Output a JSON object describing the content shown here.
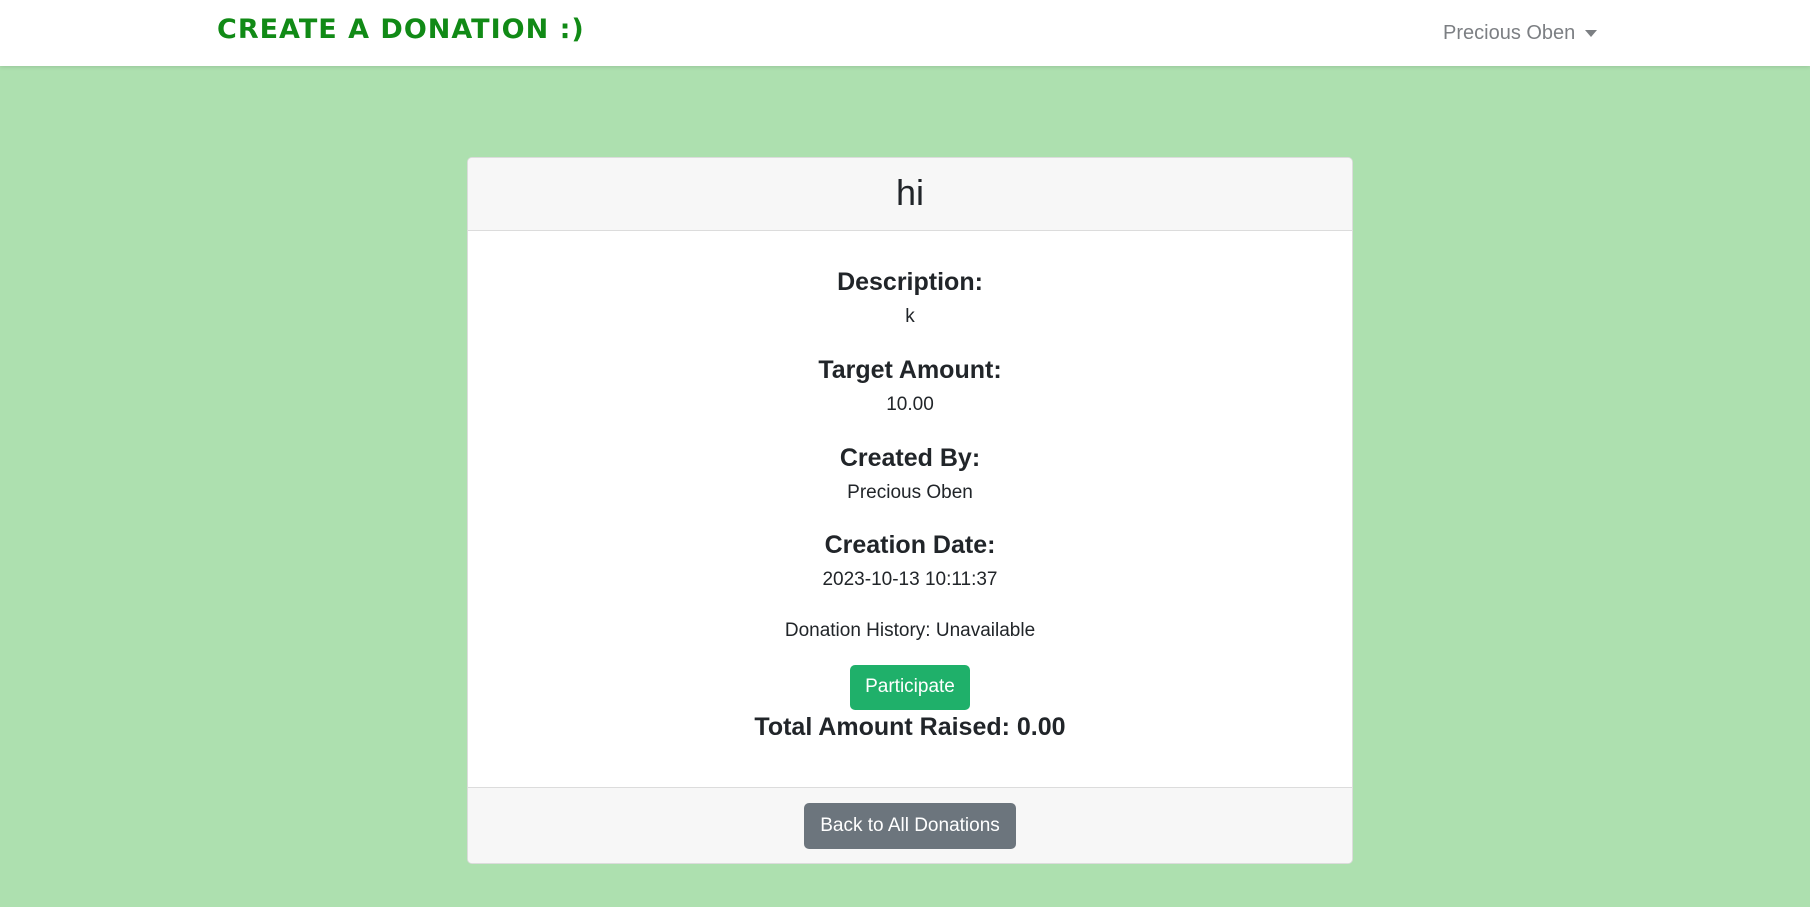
{
  "navbar": {
    "brand": "CREATE A DONATION :)",
    "user_name": "Precious Oben"
  },
  "donation": {
    "title": "hi",
    "description_label": "Description:",
    "description": "k",
    "target_label": "Target Amount:",
    "target_amount": "10.00",
    "created_by_label": "Created By:",
    "created_by": "Precious Oben",
    "creation_date_label": "Creation Date:",
    "creation_date": "2023-10-13 10:11:37",
    "history_text": "Donation History: Unavailable",
    "participate_label": "Participate",
    "total_raised_text": "Total Amount Raised: 0.00",
    "back_label": "Back to All Donations"
  },
  "colors": {
    "background": "#ade0af",
    "brand": "#118a16",
    "participate_button": "#1fb06a",
    "back_button": "#6c757d"
  },
  "icons": {
    "user_menu_caret": "caret-down-icon"
  }
}
